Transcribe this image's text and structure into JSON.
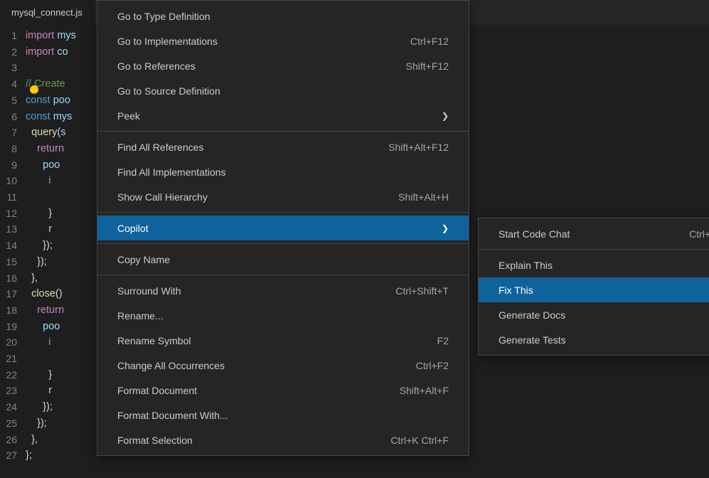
{
  "tab": {
    "filename": "mysql_connect.js"
  },
  "code": {
    "lines": [
      {
        "num": "1",
        "t": "import",
        "rest": " mys"
      },
      {
        "num": "2",
        "t": "import",
        "rest": " co"
      },
      {
        "num": "3",
        "t": "",
        "rest": ""
      },
      {
        "num": "4",
        "t": "comment",
        "rest": "// Create"
      },
      {
        "num": "5",
        "t": "const",
        "rest": " poo"
      },
      {
        "num": "6",
        "t": "const",
        "rest": " mys"
      },
      {
        "num": "7",
        "t": "fn",
        "rest": "query(s"
      },
      {
        "num": "8",
        "t": "return",
        "rest": ""
      },
      {
        "num": "9",
        "t": "var",
        "rest": "poo"
      },
      {
        "num": "10",
        "t": "if",
        "rest": ""
      },
      {
        "num": "11",
        "t": "",
        "rest": ""
      },
      {
        "num": "12",
        "t": "",
        "rest": "}"
      },
      {
        "num": "13",
        "t": "",
        "rest": "r"
      },
      {
        "num": "14",
        "t": "",
        "rest": "});"
      },
      {
        "num": "15",
        "t": "",
        "rest": "});"
      },
      {
        "num": "16",
        "t": "",
        "rest": "},"
      },
      {
        "num": "17",
        "t": "fn",
        "rest": "close()"
      },
      {
        "num": "18",
        "t": "return",
        "rest": ""
      },
      {
        "num": "19",
        "t": "var",
        "rest": "poo"
      },
      {
        "num": "20",
        "t": "if",
        "rest": ""
      },
      {
        "num": "21",
        "t": "",
        "rest": ""
      },
      {
        "num": "22",
        "t": "",
        "rest": "}"
      },
      {
        "num": "23",
        "t": "",
        "rest": "r"
      },
      {
        "num": "24",
        "t": "",
        "rest": "});"
      },
      {
        "num": "25",
        "t": "",
        "rest": "});"
      },
      {
        "num": "26",
        "t": "",
        "rest": "},"
      },
      {
        "num": "27",
        "t": "",
        "rest": "};"
      }
    ]
  },
  "contextMenu": {
    "items": [
      {
        "label": "Go to Type Definition",
        "shortcut": "",
        "type": "item"
      },
      {
        "label": "Go to Implementations",
        "shortcut": "Ctrl+F12",
        "type": "item"
      },
      {
        "label": "Go to References",
        "shortcut": "Shift+F12",
        "type": "item"
      },
      {
        "label": "Go to Source Definition",
        "shortcut": "",
        "type": "item"
      },
      {
        "label": "Peek",
        "shortcut": "",
        "type": "submenu"
      },
      {
        "type": "separator"
      },
      {
        "label": "Find All References",
        "shortcut": "Shift+Alt+F12",
        "type": "item"
      },
      {
        "label": "Find All Implementations",
        "shortcut": "",
        "type": "item"
      },
      {
        "label": "Show Call Hierarchy",
        "shortcut": "Shift+Alt+H",
        "type": "item"
      },
      {
        "type": "separator"
      },
      {
        "label": "Copilot",
        "shortcut": "",
        "type": "submenu",
        "highlighted": true
      },
      {
        "type": "separator"
      },
      {
        "label": "Copy Name",
        "shortcut": "",
        "type": "item"
      },
      {
        "type": "separator"
      },
      {
        "label": "Surround With",
        "shortcut": "Ctrl+Shift+T",
        "type": "item"
      },
      {
        "label": "Rename...",
        "shortcut": "",
        "type": "item"
      },
      {
        "label": "Rename Symbol",
        "shortcut": "F2",
        "type": "item"
      },
      {
        "label": "Change All Occurrences",
        "shortcut": "Ctrl+F2",
        "type": "item"
      },
      {
        "label": "Format Document",
        "shortcut": "Shift+Alt+F",
        "type": "item"
      },
      {
        "label": "Format Document With...",
        "shortcut": "",
        "type": "item"
      },
      {
        "label": "Format Selection",
        "shortcut": "Ctrl+K Ctrl+F",
        "type": "item"
      }
    ]
  },
  "subMenu": {
    "items": [
      {
        "label": "Start Code Chat",
        "shortcut": "Ctrl+I",
        "type": "item"
      },
      {
        "type": "separator"
      },
      {
        "label": "Explain This",
        "shortcut": "",
        "type": "item"
      },
      {
        "label": "Fix This",
        "shortcut": "",
        "type": "item",
        "highlighted": true
      },
      {
        "label": "Generate Docs",
        "shortcut": "",
        "type": "item"
      },
      {
        "label": "Generate Tests",
        "shortcut": "",
        "type": "item"
      }
    ]
  }
}
